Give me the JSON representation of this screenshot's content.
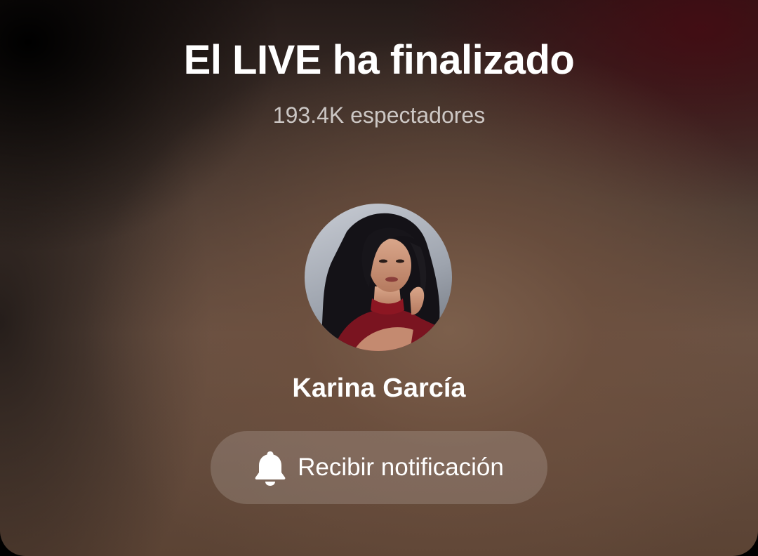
{
  "live_ended": {
    "title": "El LIVE ha finalizado",
    "viewers_text": "193.4K espectadores"
  },
  "host": {
    "name": "Karina García",
    "avatar_icon": "profile-photo"
  },
  "notify_button": {
    "label": "Recibir notificación",
    "icon": "bell-icon"
  },
  "colors": {
    "text_primary": "#ffffff",
    "text_secondary": "#c9bdb5",
    "button_bg": "rgba(255,255,255,0.16)"
  }
}
